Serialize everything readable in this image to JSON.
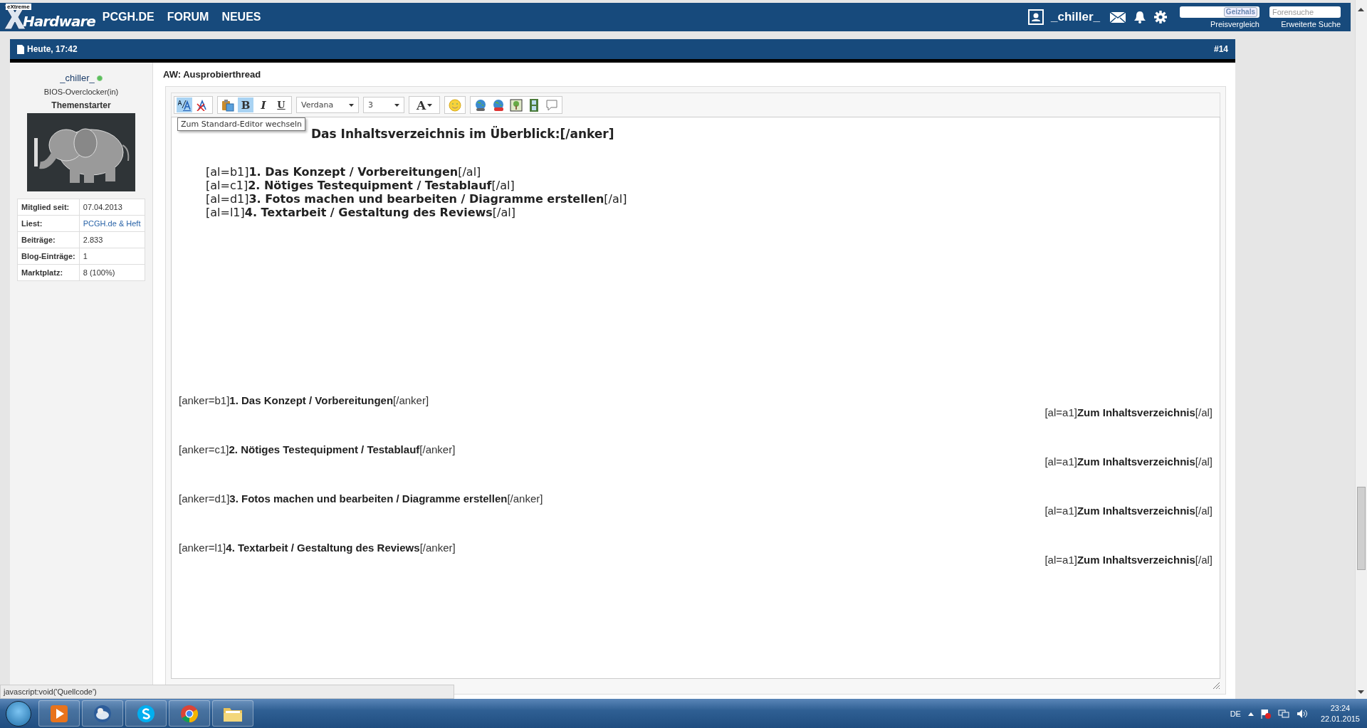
{
  "header": {
    "logo_top": "eXtreme",
    "logo_main": "Hardware",
    "nav": [
      "PCGH.DE",
      "FORUM",
      "NEUES"
    ],
    "user": "_chiller_",
    "price_search": {
      "logo": "Geizhals",
      "link": "Preisvergleich"
    },
    "forum_search": {
      "placeholder": "Forensuche",
      "link": "Erweiterte Suche"
    }
  },
  "post": {
    "date": "Heute, 17:42",
    "number": "#14",
    "author": {
      "name": "_chiller_",
      "online": true,
      "rank": "BIOS-Overclocker(in)",
      "role": "Themenstarter",
      "stats": [
        {
          "label": "Mitglied seit:",
          "value": "07.04.2013",
          "kind": "text"
        },
        {
          "label": "Liest:",
          "value": "PCGH.de & Heft",
          "kind": "link"
        },
        {
          "label": "Beiträge:",
          "value": "2.833",
          "kind": "text"
        },
        {
          "label": "Blog-Einträge:",
          "value": "1",
          "kind": "text"
        },
        {
          "label": "Marktplatz:",
          "value": "8 (100%)",
          "kind": "text"
        }
      ]
    },
    "title": "AW: Ausprobierthread",
    "editor": {
      "toolbar": [
        [
          {
            "kind": "icon",
            "active": true
          },
          {
            "kind": "icon",
            "active": false
          }
        ],
        [
          {
            "kind": "icon",
            "active": false
          },
          {
            "kind": "letter",
            "label": "B",
            "active": true
          },
          {
            "kind": "letter",
            "label": "I",
            "active": false
          },
          {
            "kind": "letter",
            "label": "U",
            "active": false
          }
        ],
        [
          {
            "kind": "select",
            "value": "Verdana"
          }
        ],
        [
          {
            "kind": "select",
            "value": "3"
          }
        ],
        [
          {
            "kind": "color",
            "label": "A"
          }
        ],
        [
          {
            "kind": "icon",
            "active": false
          }
        ],
        [
          {
            "kind": "icon",
            "active": false
          },
          {
            "kind": "icon",
            "active": false
          },
          {
            "kind": "icon",
            "active": false
          },
          {
            "kind": "icon",
            "active": false
          },
          {
            "kind": "icon",
            "active": false
          }
        ]
      ],
      "tooltip": "Zum Standard-Editor wechseln",
      "heading": "Das Inhaltsverzeichnis im Überblick:[/anker]",
      "toc": [
        "[al=b1]**1. Das Konzept / Vorbereitungen**[/al]",
        "[al=c1]**2. Nötiges Testequipment / Testablauf**[/al]",
        "[al=d1]**3. Fotos machen und bearbeiten / Diagramme erstellen**[/al]",
        "[al=l1]**4. Textarbeit / Gestaltung des Reviews**[/al]"
      ],
      "sections": [
        {
          "anchor": "[anker=b1]**1. Das Konzept / Vorbereitungen**[/anker]",
          "back": "[al=a1]**Zum Inhaltsverzeichnis**[/al]"
        },
        {
          "anchor": "[anker=c1]**2. Nötiges Testequipment / Testablauf**[/anker]",
          "back": "[al=a1]**Zum Inhaltsverzeichnis**[/al]"
        },
        {
          "anchor": "[anker=d1]**3. Fotos machen und bearbeiten / Diagramme erstellen**[/anker]",
          "back": "[al=a1]**Zum Inhaltsverzeichnis**[/al]"
        },
        {
          "anchor": "[anker=l1]**4. Textarbeit / Gestaltung des Reviews**[/anker]",
          "back": "[al=a1]**Zum Inhaltsverzeichnis**[/al]"
        }
      ]
    }
  },
  "status_text": "javascript:void('Quellcode')",
  "taskbar": {
    "language": "DE",
    "time": "23:24",
    "date": "22.01.2015"
  }
}
